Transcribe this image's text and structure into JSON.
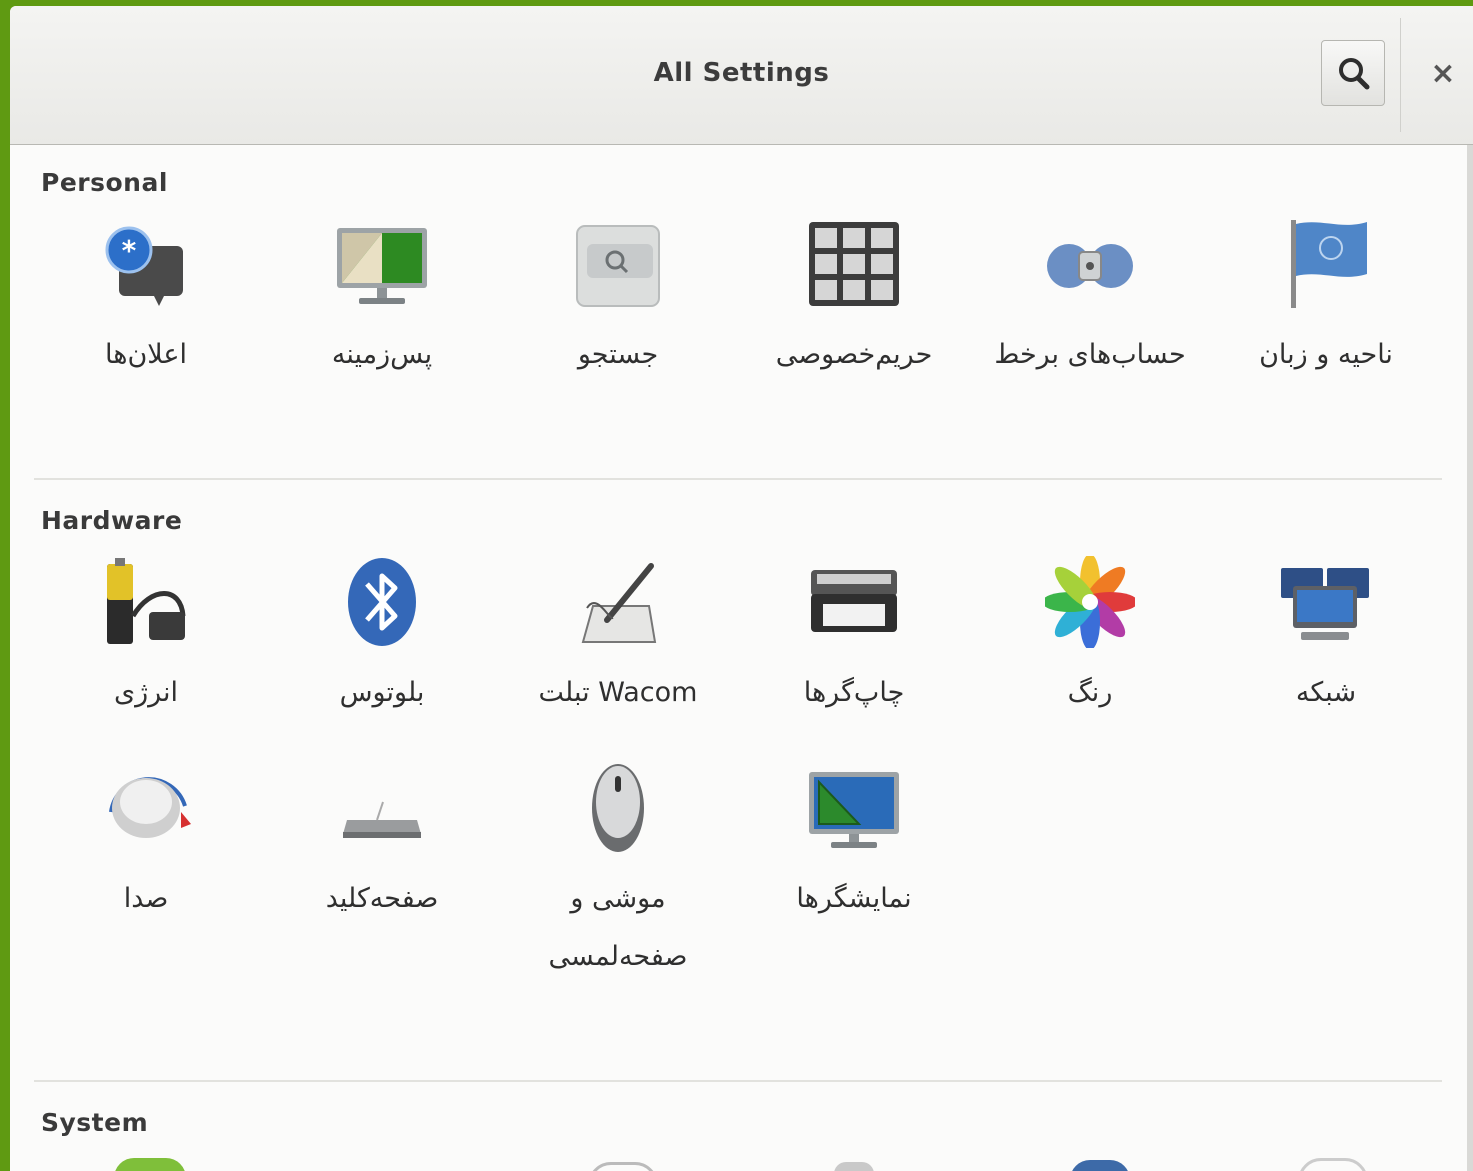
{
  "window": {
    "title": "All Settings",
    "search_icon": "search-icon",
    "close_icon": "close-icon",
    "close_glyph": "×"
  },
  "sections": {
    "personal": {
      "title": "Personal",
      "items": [
        {
          "label": "اعلان‌ها",
          "icon": "notifications-icon"
        },
        {
          "label": "پس‌زمینه",
          "icon": "background-icon"
        },
        {
          "label": "جستجو",
          "icon": "search-settings-icon"
        },
        {
          "label": "حریم‌خصوصی",
          "icon": "privacy-icon"
        },
        {
          "label": "حساب‌های برخط",
          "icon": "online-accounts-icon"
        },
        {
          "label": "ناحیه و زبان",
          "icon": "region-language-icon"
        }
      ]
    },
    "hardware": {
      "title": "Hardware",
      "items": [
        {
          "label": "انرژی",
          "icon": "power-icon"
        },
        {
          "label": "بلوتوس",
          "icon": "bluetooth-icon"
        },
        {
          "label": "تبلت Wacom",
          "icon": "wacom-tablet-icon"
        },
        {
          "label": "چاپ‌گرها",
          "icon": "printer-icon"
        },
        {
          "label": "رنگ",
          "icon": "color-icon"
        },
        {
          "label": "شبکه",
          "icon": "network-icon"
        },
        {
          "label": "صدا",
          "icon": "sound-icon"
        },
        {
          "label": "صفحه‌کلید",
          "icon": "keyboard-icon"
        },
        {
          "label": "موشی و صفحه‌لمسی",
          "icon": "mouse-touchpad-icon"
        },
        {
          "label": "نمایشگرها",
          "icon": "displays-icon"
        }
      ]
    },
    "system": {
      "title": "System"
    }
  },
  "colors": {
    "desktop_accent": "#5f9a12",
    "bluetooth": "#3468b8",
    "display_screen": "#2c8a2c"
  }
}
